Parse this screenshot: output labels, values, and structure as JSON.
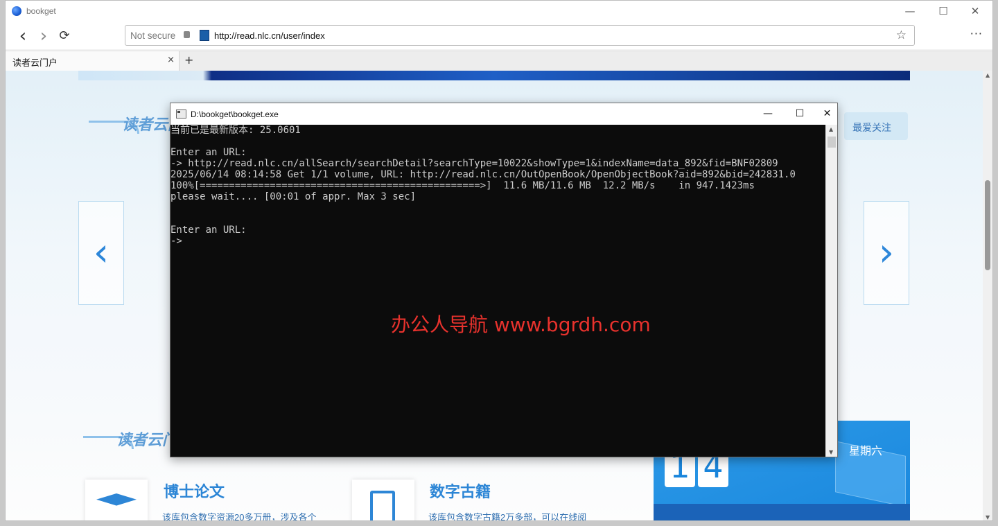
{
  "browser": {
    "window_title": "bookget",
    "controls": {
      "minimize": "—",
      "maximize": "☐",
      "close": "✕"
    },
    "nav": {
      "back": "‹",
      "forward": "›",
      "reload": "⟳"
    },
    "address": {
      "security": "Not secure",
      "url": "http://read.nlc.cn/user/index"
    },
    "bookmark_star": "☆",
    "menu": "···",
    "tabs": [
      {
        "label": "读者云门户",
        "close": "×"
      }
    ],
    "new_tab": "+"
  },
  "page": {
    "logo_text": "读者云门户",
    "logo_text_2": "读者云门户",
    "favorites_button": "最爱关注",
    "carousel": {
      "prev": "‹",
      "next": "›"
    },
    "calendar": {
      "day_digits": [
        "1",
        "4"
      ],
      "weekday": "星期六"
    },
    "cards": [
      {
        "title": "博士论文",
        "desc": "该库包含数字资源20多万册，涉及各个",
        "icon": "graduation-cap-icon"
      },
      {
        "title": "数字古籍",
        "desc": "该库包含数字古籍2万多部，可以在线阅",
        "icon": "book-icon"
      }
    ]
  },
  "console_window": {
    "title": "D:\\bookget\\bookget.exe",
    "controls": {
      "minimize": "—",
      "maximize": "☐",
      "close": "✕"
    },
    "lines": [
      "当前已是最新版本: 25.0601",
      "",
      "Enter an URL:",
      "-> http://read.nlc.cn/allSearch/searchDetail?searchType=10022&showType=1&indexName=data_892&fid=BNF02809",
      "2025/06/14 08:14:58 Get 1/1 volume, URL: http://read.nlc.cn/OutOpenBook/OpenObjectBook?aid=892&bid=242831.0",
      "100%[================================================>]  11.6 MB/11.6 MB  12.2 MB/s    in 947.1423ms",
      "please wait.... [00:01 of appr. Max 3 sec]",
      "",
      "",
      "Enter an URL:",
      "->"
    ],
    "scroll": {
      "up": "▲",
      "down": "▼"
    }
  },
  "watermark": "办公人导航  www.bgrdh.com",
  "page_scroll": {
    "up": "▲",
    "down": "▼"
  }
}
